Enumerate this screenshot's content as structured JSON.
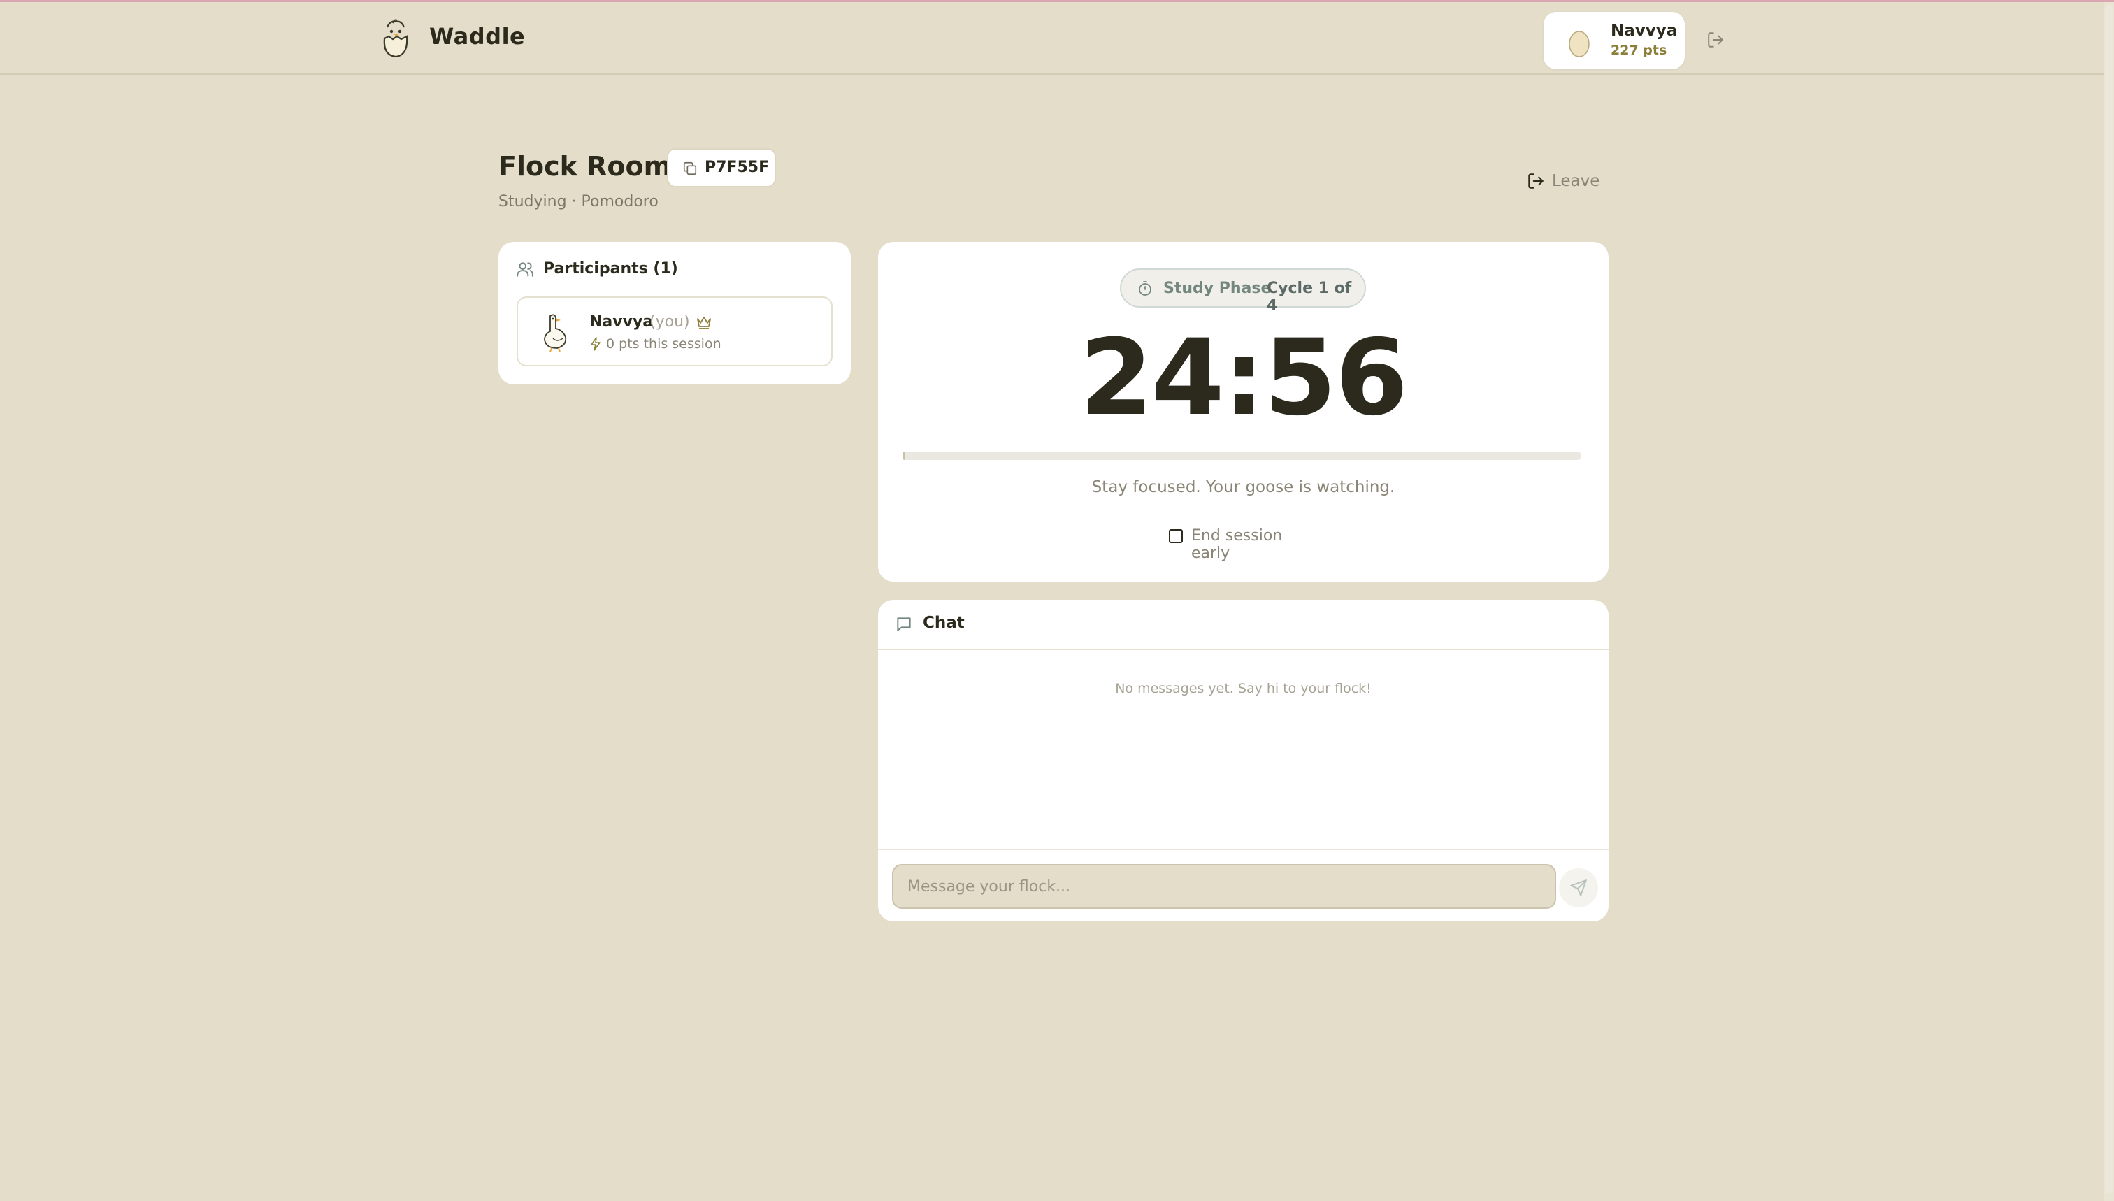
{
  "header": {
    "app_name": "Waddle",
    "user_name": "Navvya",
    "user_points": "227 pts"
  },
  "room": {
    "title": "Flock Room",
    "code": "P7F55F",
    "subtitle": "Studying · Pomodoro",
    "leave_label": "Leave"
  },
  "participants": {
    "title": "Participants (1)",
    "items": [
      {
        "name": "Navvya",
        "tag": "(you)",
        "points": "0 pts this session",
        "is_host": true
      }
    ]
  },
  "timer": {
    "phase": "Study Phase",
    "cycle": "Cycle 1 of 4",
    "time": "24:56",
    "progress": 0.003,
    "message": "Stay focused. Your goose is watching.",
    "end_early_label": "End session early",
    "end_early_checked": false
  },
  "chat": {
    "title": "Chat",
    "empty_message": "No messages yet. Say hi to your flock!",
    "input_placeholder": "Message your flock...",
    "input_value": ""
  },
  "colors": {
    "background": "#e4ddca",
    "card": "#ffffff",
    "text": "#2b2a1c",
    "muted": "#8a8576",
    "points": "#8b7f3a",
    "phase": "#73867f"
  }
}
